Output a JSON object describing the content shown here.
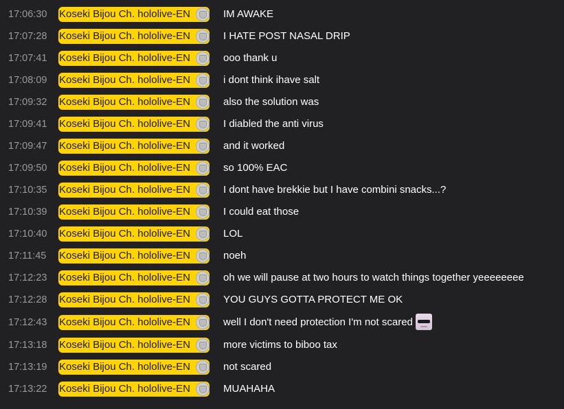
{
  "author": {
    "name": "Koseki Bijou Ch. hololive-EN",
    "badge_icon": "member-badge-icon",
    "highlight_color": "#ffd400"
  },
  "messages": [
    {
      "time": "17:06:30",
      "text": "IM AWAKE"
    },
    {
      "time": "17:07:28",
      "text": "I HATE POST NASAL DRIP"
    },
    {
      "time": "17:07:41",
      "text": "ooo thank u"
    },
    {
      "time": "17:08:09",
      "text": "i dont think ihave salt"
    },
    {
      "time": "17:09:32",
      "text": "also the solution was"
    },
    {
      "time": "17:09:41",
      "text": "I diabled the anti virus"
    },
    {
      "time": "17:09:47",
      "text": "and it worked"
    },
    {
      "time": "17:09:50",
      "text": "so 100% EAC"
    },
    {
      "time": "17:10:35",
      "text": "I dont have brekkie but I have combini snacks...?"
    },
    {
      "time": "17:10:39",
      "text": "I could eat those"
    },
    {
      "time": "17:10:40",
      "text": "LOL"
    },
    {
      "time": "17:11:45",
      "text": "noeh"
    },
    {
      "time": "17:12:23",
      "text": "oh we will pause at two hours to watch things together yeeeeeeee"
    },
    {
      "time": "17:12:28",
      "text": "YOU GUYS GOTTA PROTECT ME OK"
    },
    {
      "time": "17:12:43",
      "text": "well I don't need protection I'm not scared",
      "emote": "sunglasses-emote-icon"
    },
    {
      "time": "17:13:18",
      "text": "more victims to biboo tax"
    },
    {
      "time": "17:13:19",
      "text": "not scared"
    },
    {
      "time": "17:13:22",
      "text": "MUAHAHA"
    }
  ]
}
